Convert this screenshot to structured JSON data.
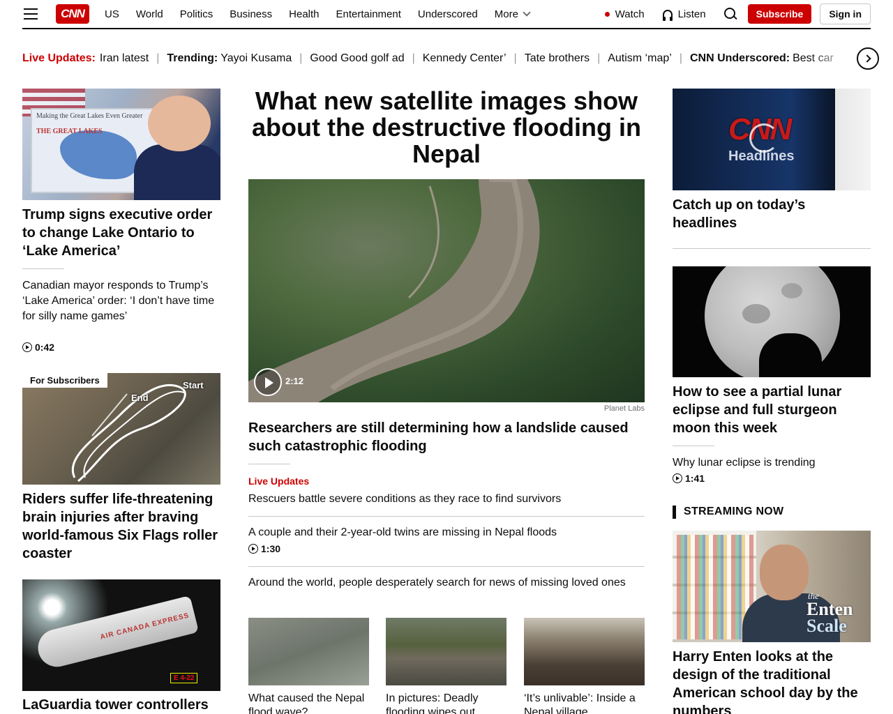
{
  "header": {
    "logo": "CNN",
    "nav": [
      "US",
      "World",
      "Politics",
      "Business",
      "Health",
      "Entertainment",
      "Underscored"
    ],
    "more": "More",
    "watch": "Watch",
    "listen": "Listen",
    "subscribe": "Subscribe",
    "signin": "Sign in",
    "accent": "#cc0000"
  },
  "ticker": {
    "live_label": "Live Updates:",
    "live_text": "Iran latest",
    "trending_label": "Trending:",
    "trending_text": "Yayoi Kusama",
    "items": [
      "Good Good golf ad",
      "Kennedy Center’",
      "Tate brothers",
      "Autism ‘map’"
    ],
    "underscored_label": "CNN Underscored:",
    "underscored_text": "Best car"
  },
  "left": {
    "story1": {
      "image_text": "Making the Great Lakes Even Greater",
      "image_text2": "THE GREAT LAKES",
      "headline": "Trump signs executive order to change Lake Ontario to ‘Lake America’",
      "sub": "Canadian mayor responds to Trump’s ‘Lake America’ order: ‘I don’t have time for silly name games’",
      "video_duration": "0:42"
    },
    "story2": {
      "tag": "For Subscribers",
      "label_start": "Start",
      "label_end": "End",
      "headline": "Riders suffer life-threatening brain injuries after braving world-famous Six Flags roller coaster"
    },
    "story3": {
      "image_text": "AIR CANADA EXPRESS",
      "image_sign": "E 4-22",
      "headline": "LaGuardia tower controllers"
    }
  },
  "center": {
    "title": "What new satellite images show about the destructive flooding in Nepal",
    "video_duration": "2:12",
    "credit": "Planet Labs",
    "headline": "Researchers are still determining how a landslide caused such catastrophic flooding",
    "live_label": "Live Updates",
    "live_text": "Rescuers battle severe conditions as they race to find survivors",
    "item2": "A couple and their 2-year-old twins are missing in Nepal floods",
    "item2_duration": "1:30",
    "item3": "Around the world, people desperately search for news of missing loved ones",
    "thumbs": [
      {
        "caption": "What caused the Nepal flood wave?"
      },
      {
        "caption": "In pictures: Deadly flooding wipes out"
      },
      {
        "caption": "‘It’s unlivable’: Inside a Nepal village"
      }
    ]
  },
  "right": {
    "story1": {
      "image_logo": "CNN",
      "image_word": "Headlines",
      "headline": "Catch up on today’s headlines"
    },
    "story2": {
      "headline": "How to see a partial lunar eclipse and full sturgeon moon this week",
      "sub": "Why lunar eclipse is trending",
      "video_duration": "1:41"
    },
    "streaming_label": "STREAMING NOW",
    "story3": {
      "image_the": "the",
      "image_t1": "Enten",
      "image_t2": "Scale",
      "headline": "Harry Enten looks at the design of the traditional American school day by the numbers"
    }
  }
}
